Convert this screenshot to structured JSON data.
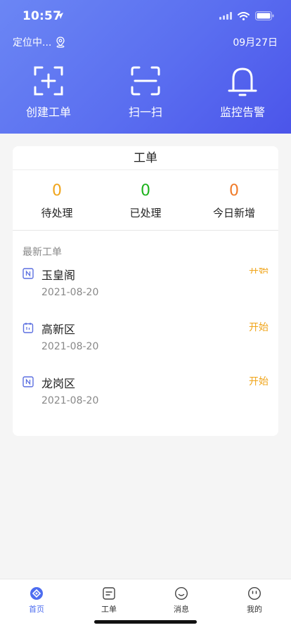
{
  "status": {
    "time": "10:57"
  },
  "header": {
    "location": "定位中...",
    "date": "09月27日",
    "actions": [
      {
        "label": "创建工单",
        "icon": "create-work-order-icon"
      },
      {
        "label": "扫一扫",
        "icon": "scan-icon"
      },
      {
        "label": "监控告警",
        "icon": "bell-icon"
      }
    ]
  },
  "card": {
    "title": "工单",
    "stats": [
      {
        "value": "0",
        "label": "待处理",
        "color": "#f0a51b"
      },
      {
        "value": "0",
        "label": "已处理",
        "color": "#1db31d"
      },
      {
        "value": "0",
        "label": "今日新增",
        "color": "#f07a28"
      }
    ],
    "latest_title": "最新工单",
    "items": [
      {
        "name": "玉皇阁",
        "date": "2021-08-20",
        "status": "开始"
      },
      {
        "name": "高新区",
        "date": "2021-08-20",
        "status": "开始"
      },
      {
        "name": "龙岗区",
        "date": "2021-08-20",
        "status": "开始"
      }
    ]
  },
  "tabbar": {
    "tabs": [
      {
        "label": "首页",
        "icon": "home-icon"
      },
      {
        "label": "工单",
        "icon": "work-order-icon"
      },
      {
        "label": "消息",
        "icon": "message-icon"
      },
      {
        "label": "我的",
        "icon": "profile-icon"
      }
    ]
  },
  "colors": {
    "accent": "#4d6df0",
    "status_start": "#f0a51b"
  }
}
